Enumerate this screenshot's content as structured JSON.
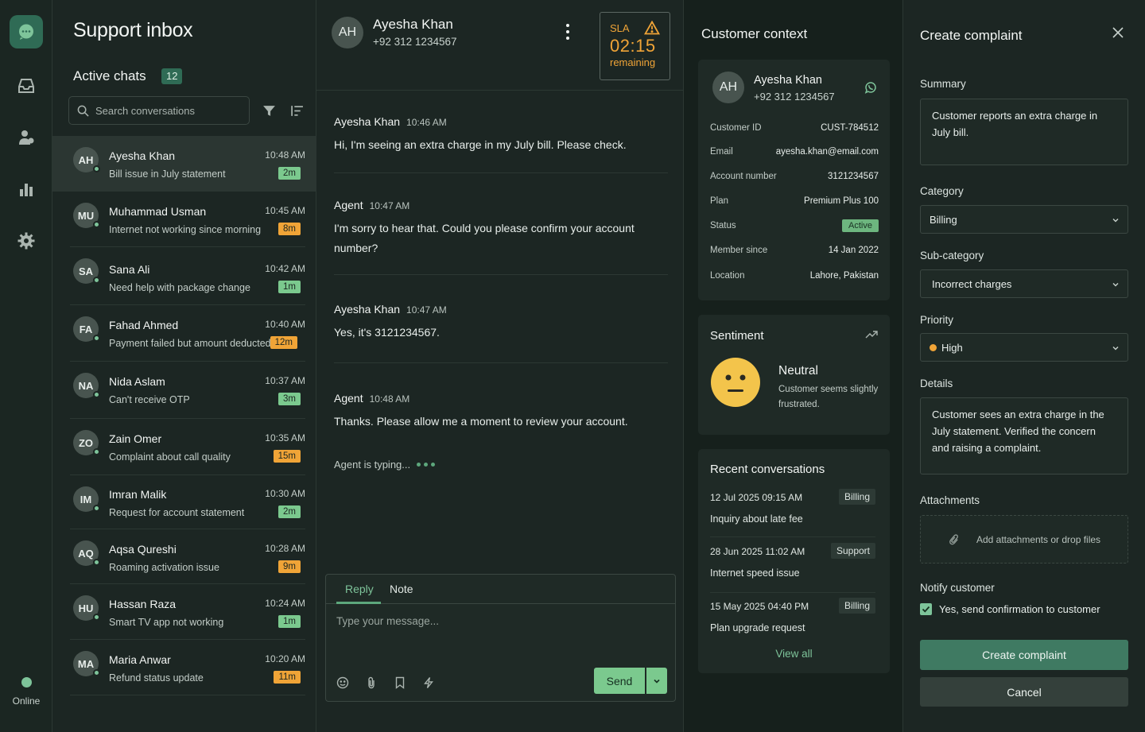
{
  "rail": {
    "online_label": "Online"
  },
  "inbox": {
    "title": "Support inbox",
    "active_title": "Active chats",
    "active_count": "12",
    "search_placeholder": "Search conversations",
    "chats": [
      {
        "initials": "AH",
        "name": "Ayesha Khan",
        "preview": "Bill issue in July statement",
        "time": "10:48 AM",
        "wait": "2m",
        "wait_color": "green",
        "selected": true
      },
      {
        "initials": "MU",
        "name": "Muhammad Usman",
        "preview": "Internet not working since morning",
        "time": "10:45 AM",
        "wait": "8m",
        "wait_color": "orange"
      },
      {
        "initials": "SA",
        "name": "Sana Ali",
        "preview": "Need help with package change",
        "time": "10:42 AM",
        "wait": "1m",
        "wait_color": "green"
      },
      {
        "initials": "FA",
        "name": "Fahad Ahmed",
        "preview": "Payment failed but amount deducted",
        "time": "10:40 AM",
        "wait": "12m",
        "wait_color": "orange"
      },
      {
        "initials": "NA",
        "name": "Nida Aslam",
        "preview": "Can't receive OTP",
        "time": "10:37 AM",
        "wait": "3m",
        "wait_color": "green"
      },
      {
        "initials": "ZO",
        "name": "Zain Omer",
        "preview": "Complaint about call quality",
        "time": "10:35 AM",
        "wait": "15m",
        "wait_color": "orange"
      },
      {
        "initials": "IM",
        "name": "Imran Malik",
        "preview": "Request for account statement",
        "time": "10:30 AM",
        "wait": "2m",
        "wait_color": "green"
      },
      {
        "initials": "AQ",
        "name": "Aqsa Qureshi",
        "preview": "Roaming activation issue",
        "time": "10:28 AM",
        "wait": "9m",
        "wait_color": "orange"
      },
      {
        "initials": "HU",
        "name": "Hassan Raza",
        "preview": "Smart TV app not working",
        "time": "10:24 AM",
        "wait": "1m",
        "wait_color": "green"
      },
      {
        "initials": "MA",
        "name": "Maria Anwar",
        "preview": "Refund status update",
        "time": "10:20 AM",
        "wait": "11m",
        "wait_color": "orange"
      }
    ]
  },
  "conversation": {
    "initials": "AH",
    "name": "Ayesha Khan",
    "phone": "+92 312 1234567",
    "sla": {
      "label": "SLA",
      "time": "02:15",
      "sub": "remaining"
    },
    "messages": [
      {
        "sender": "Ayesha Khan",
        "time": "10:46 AM",
        "body": "Hi, I'm seeing an extra charge in my July bill. Please check."
      },
      {
        "sender": "Agent",
        "time": "10:47 AM",
        "body": "I'm sorry to hear that. Could you please confirm your account number?"
      },
      {
        "sender": "Ayesha Khan",
        "time": "10:47 AM",
        "body": "Yes, it's 3121234567."
      },
      {
        "sender": "Agent",
        "time": "10:48 AM",
        "body": "Thanks. Please allow me a moment to review your account."
      }
    ],
    "typing": "Agent is typing...",
    "composer": {
      "tab_reply": "Reply",
      "tab_note": "Note",
      "placeholder": "Type your message...",
      "send_label": "Send"
    }
  },
  "context": {
    "title": "Customer context",
    "initials": "AH",
    "name": "Ayesha Khan",
    "phone": "+92 312 1234567",
    "fields": [
      {
        "key": "Customer ID",
        "value": "CUST-784512"
      },
      {
        "key": "Email",
        "value": "ayesha.khan@email.com"
      },
      {
        "key": "Account number",
        "value": "3121234567"
      },
      {
        "key": "Plan",
        "value": "Premium Plus 100"
      },
      {
        "key": "Status",
        "value": "Active"
      },
      {
        "key": "Member since",
        "value": "14 Jan 2022"
      },
      {
        "key": "Location",
        "value": "Lahore, Pakistan"
      }
    ],
    "sentiment": {
      "title": "Sentiment",
      "value": "Neutral",
      "desc": "Customer seems slightly frustrated."
    },
    "recent": {
      "title": "Recent conversations",
      "items": [
        {
          "date": "12 Jul 2025   09:15 AM",
          "tag": "Billing",
          "desc": "Inquiry about late fee"
        },
        {
          "date": "28 Jun 2025   11:02 AM",
          "tag": "Support",
          "desc": "Internet speed issue"
        },
        {
          "date": "15 May 2025   04:40 PM",
          "tag": "Billing",
          "desc": "Plan upgrade request"
        }
      ],
      "view_all": "View all"
    }
  },
  "complaint": {
    "title": "Create complaint",
    "summary_label": "Summary",
    "summary": "Customer reports an extra charge in July bill.",
    "category_label": "Category",
    "category": "Billing",
    "subcategory_label": "Sub-category",
    "subcategory": "Incorrect charges",
    "priority_label": "Priority",
    "priority": "High",
    "priority_color": "#f0a437",
    "details_label": "Details",
    "details": "Customer sees an extra charge in the July statement. Verified the concern and raising a complaint.",
    "attachments_label": "Attachments",
    "attachments_placeholder": "Add attachments or drop files",
    "notify_label": "Notify customer",
    "notify_check": "Yes, send confirmation to customer",
    "create_label": "Create complaint",
    "cancel_label": "Cancel"
  }
}
